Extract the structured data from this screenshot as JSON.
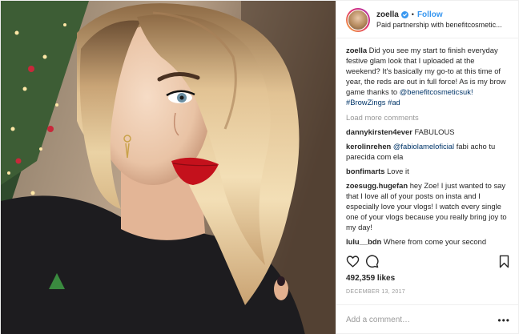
{
  "header": {
    "username": "zoella",
    "follow_label": "Follow",
    "separator": "•",
    "partnership": "Paid partnership with benefitcosmetic..."
  },
  "caption": {
    "username": "zoella",
    "text": "Did you see my start to finish everyday festive glam look that I uploaded at the weekend? It's basically my go-to at this time of year, the reds are out in full force! As is my brow game thanks to",
    "mention": "@benefitcosmeticsuk!",
    "hashtag1": "#BrowZings",
    "hashtag2": "#ad"
  },
  "load_more": "Load more comments",
  "comments": [
    {
      "username": "dannykirsten4ever",
      "text": "FABULOUS"
    },
    {
      "username": "kerolinrehen",
      "mention": "@fabiolameloficial",
      "text": "fabi acho tu parecida com ela"
    },
    {
      "username": "bonfimarts",
      "text": "Love it"
    },
    {
      "username": "zoesugg.hugefan",
      "text": "hey Zoe! I just wanted to say that I love all of your posts on insta and I especially love your vlogs! I watch every single one of your vlogs because you really bring joy to my day!"
    },
    {
      "username": "lulu__bdn",
      "text": "Where from come your second earrings?"
    }
  ],
  "likes": "492,359 likes",
  "date": "DECEMBER 13, 2017",
  "add_comment": {
    "placeholder": "Add a comment…",
    "more": "•••"
  },
  "icons": {
    "like": "heart-outline-icon",
    "comment": "speech-bubble-icon",
    "save": "bookmark-icon",
    "verified": "verified-badge-icon"
  },
  "colors": {
    "follow": "#3897f0",
    "link": "#003569",
    "muted": "#999999",
    "text": "#262626",
    "verified": "#3897f0"
  }
}
